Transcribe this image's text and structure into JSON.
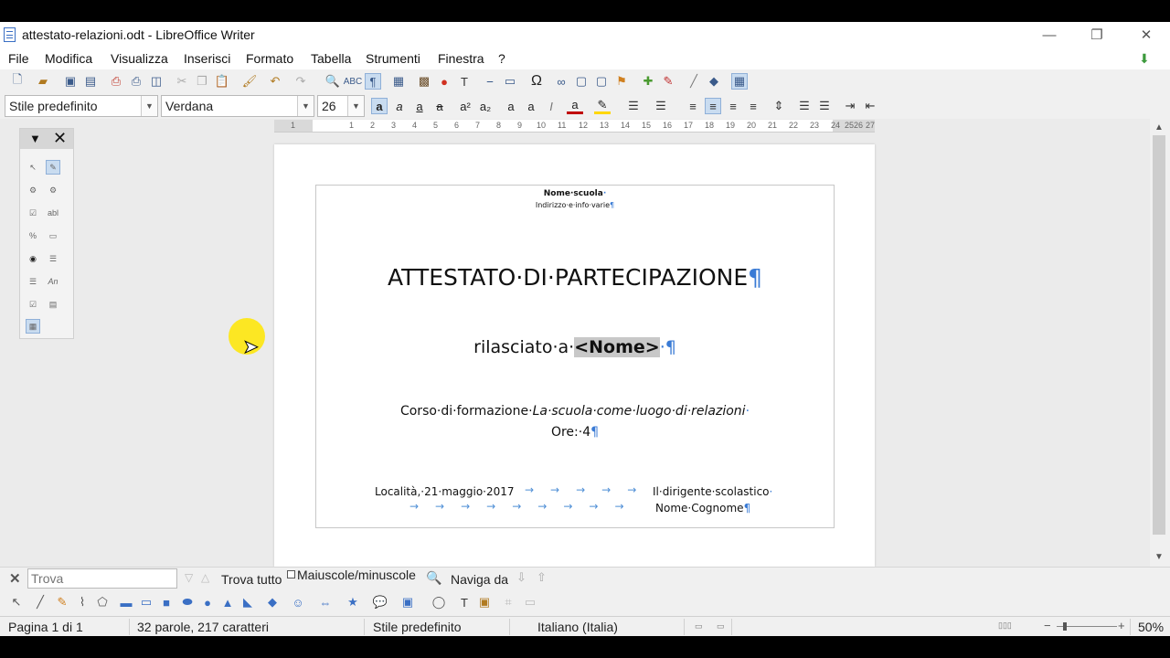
{
  "window": {
    "title": "attestato-relazioni.odt - LibreOffice Writer",
    "minimize": "—",
    "restore": "❐",
    "close": "✕"
  },
  "menu": [
    "File",
    "Modifica",
    "Visualizza",
    "Inserisci",
    "Formato",
    "Tabella",
    "Strumenti",
    "Finestra",
    "?"
  ],
  "formatting": {
    "paragraph_style": "Stile predefinito",
    "font_name": "Verdana",
    "font_size": "26"
  },
  "ruler": {
    "ticks": [
      "1",
      "1",
      "2",
      "3",
      "4",
      "5",
      "6",
      "7",
      "8",
      "9",
      "10",
      "11",
      "12",
      "13",
      "14",
      "15",
      "16",
      "17",
      "18",
      "19",
      "20",
      "21",
      "22",
      "23",
      "24",
      "25",
      "26",
      "27"
    ]
  },
  "document": {
    "school_name": "Nome·scuola",
    "school_address": "Indirizzo·e·info·varie",
    "heading": "ATTESTATO·DI·PARTECIPAZIONE",
    "issued_to": "rilasciato·a·",
    "name_field": "<Nome>",
    "course_prefix": "Corso·di·formazione·",
    "course_title": "La·scuola·come·luogo·di·relazioni",
    "hours": "Ore:·4",
    "place_date": "Località,·21·maggio·2017",
    "principal_role": "Il·dirigente·scolastico",
    "principal_name": "Nome·Cognome",
    "pilcrow": "¶",
    "dot": "·"
  },
  "findbar": {
    "placeholder": "Trova",
    "find_all": "Trova tutto",
    "match_case": "Maiuscole/minuscole",
    "navigate_by": "Naviga da"
  },
  "status": {
    "page": "Pagina 1 di 1",
    "words": "32 parole, 217 caratteri",
    "style": "Stile predefinito",
    "language": "Italiano (Italia)",
    "zoom": "50%"
  }
}
